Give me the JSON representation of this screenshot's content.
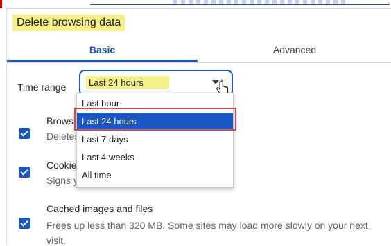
{
  "dialog": {
    "title": "Delete browsing data",
    "tabs": [
      {
        "label": "Basic"
      },
      {
        "label": "Advanced"
      }
    ]
  },
  "time_range": {
    "label": "Time range",
    "selected": "Last 24 hours",
    "options": [
      "Last hour",
      "Last 24 hours",
      "Last 7 days",
      "Last 4 weeks",
      "All time"
    ]
  },
  "items": [
    {
      "title": "Browsi",
      "subtitle": "Deletes",
      "checked": true
    },
    {
      "title": "Cookies",
      "subtitle": "Signs y",
      "checked": true
    },
    {
      "title": "Cached images and files",
      "subtitle": "Frees up less than 320 MB. Some sites may load more slowly on your next",
      "subtitle2": "visit.",
      "checked": true
    }
  ],
  "colors": {
    "accent": "#1a56c4",
    "highlight": "#f7f08a",
    "annotation": "#e04848"
  }
}
